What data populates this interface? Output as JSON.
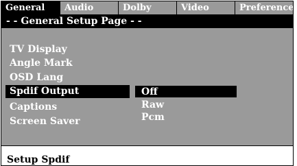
{
  "tabs": [
    {
      "label": "General",
      "active": true
    },
    {
      "label": "Audio",
      "active": false
    },
    {
      "label": "Dolby",
      "active": false
    },
    {
      "label": "Video",
      "active": false
    },
    {
      "label": "Preference",
      "active": false
    }
  ],
  "page_title": "- - General Setup Page - -",
  "menu": {
    "items": [
      {
        "label": "TV Display"
      },
      {
        "label": "Angle Mark"
      },
      {
        "label": "OSD Lang"
      },
      {
        "label": "Spdif Output",
        "selected": true
      },
      {
        "label": "Captions"
      },
      {
        "label": "Screen Saver"
      }
    ]
  },
  "options": {
    "items": [
      {
        "label": "Off",
        "selected": true
      },
      {
        "label": "Raw"
      },
      {
        "label": "Pcm"
      }
    ]
  },
  "status": {
    "text": "Setup Spdif"
  },
  "colors": {
    "panel": "#9a9a9a",
    "highlight": "#000000",
    "text": "#ffffff"
  }
}
